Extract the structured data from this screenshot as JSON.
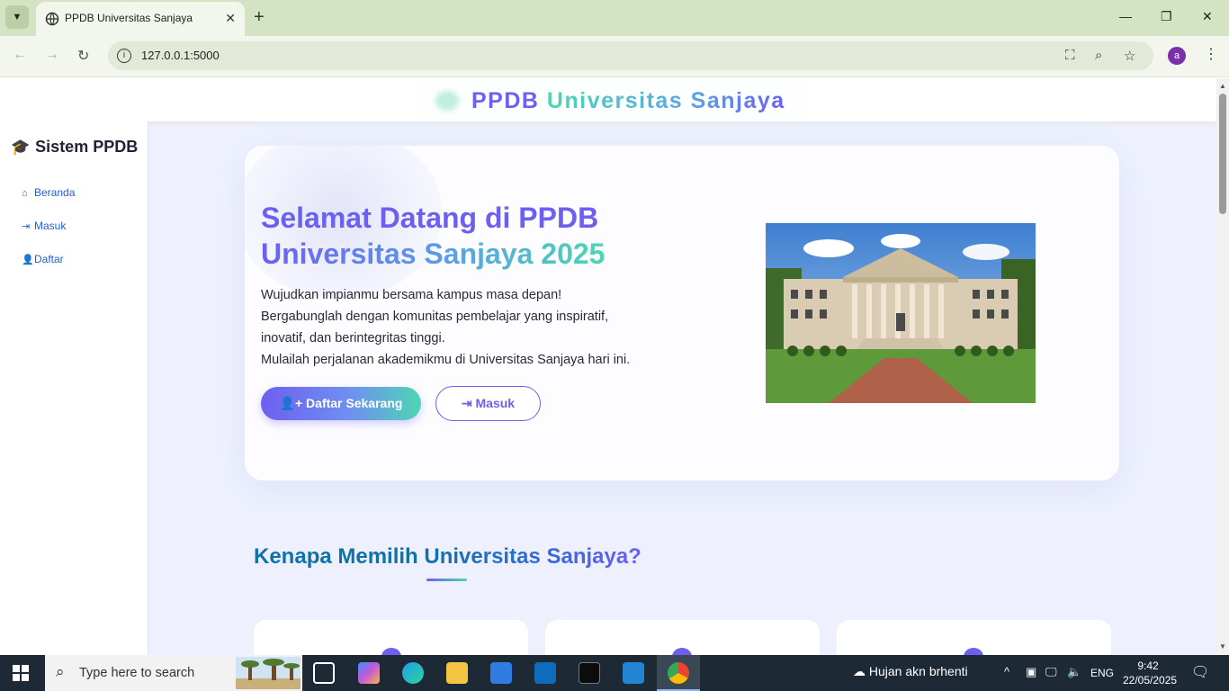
{
  "browser": {
    "tab_title": "PPDB Universitas Sanjaya",
    "url": "127.0.0.1:5000",
    "profile_initial": "a",
    "new_tab_label": "+",
    "close_tab_label": "✕"
  },
  "header": {
    "brand_part1": "PPDB",
    "brand_part2": "Universitas Sanjaya"
  },
  "sidebar": {
    "title": "Sistem PPDB",
    "items": [
      {
        "label": "Beranda",
        "icon": "home-icon"
      },
      {
        "label": "Masuk",
        "icon": "sign-in-icon"
      },
      {
        "label": "Daftar",
        "icon": "user-plus-icon"
      }
    ]
  },
  "hero": {
    "title_part1": "Selamat Datang di PPDB",
    "title_part2": "Universitas Sanjaya 2025",
    "description_lines": [
      "Wujudkan impianmu bersama kampus masa depan!",
      "Bergabunglah dengan komunitas pembelajar yang inspiratif,",
      "inovatif, dan berintegritas tinggi.",
      "Mulailah perjalanan akademikmu di Universitas Sanjaya hari ini."
    ],
    "primary_button": "Daftar Sekarang",
    "secondary_button": "Masuk"
  },
  "why": {
    "title_part1": "Kenapa Memilih",
    "title_part2": "Universitas Sanjaya?"
  },
  "taskbar": {
    "search_placeholder": "Type here to search",
    "weather": "Hujan akn brhenti",
    "language": "ENG",
    "time": "9:42",
    "date": "22/05/2025"
  },
  "colors": {
    "accent_purple": "#6d5ff0",
    "accent_teal": "#4ed6b2",
    "link_blue": "#1f5fd6",
    "heading_blue": "#0f72a8",
    "tabbar_green": "#d3e3c3"
  }
}
